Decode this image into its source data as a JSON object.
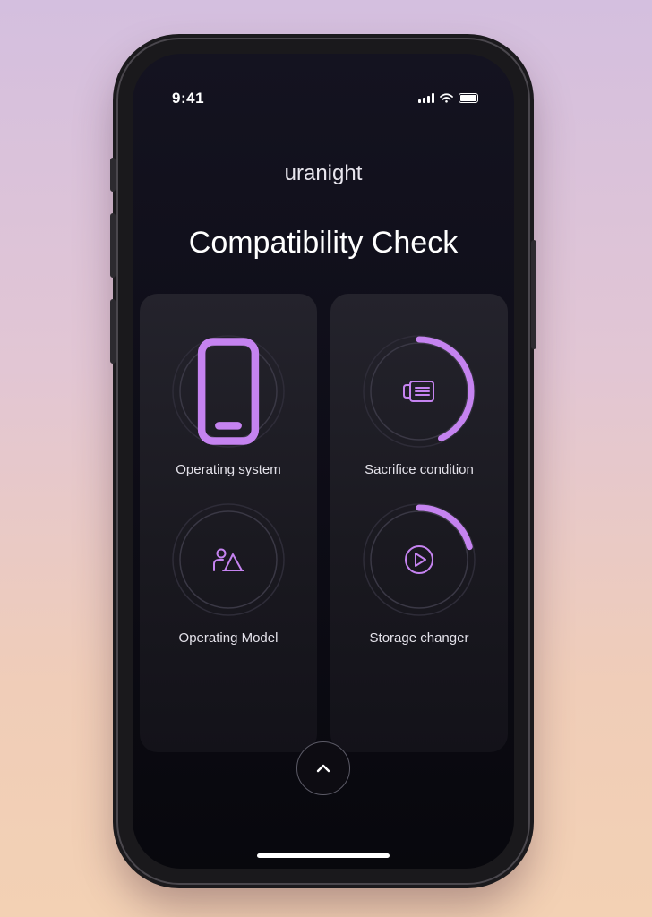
{
  "status_bar": {
    "time": "9:41"
  },
  "header": {
    "brand": "uranight",
    "title": "Compatibility Check"
  },
  "checks": [
    {
      "label": "Operating system",
      "icon": "smartphone-icon",
      "progress": 0
    },
    {
      "label": "Sacrifice condition",
      "icon": "id-card-icon",
      "progress": 0.43
    },
    {
      "label": "Operating Model",
      "icon": "person-triangle-icon",
      "progress": 0
    },
    {
      "label": "Storage changer",
      "icon": "play-icon",
      "progress": 0.21
    }
  ],
  "actions": {
    "expand_icon": "chevron-up-icon"
  },
  "colors": {
    "accent": "#c583f0",
    "ring_track": "#3a3845",
    "ring_outer": "#2e2c38"
  }
}
